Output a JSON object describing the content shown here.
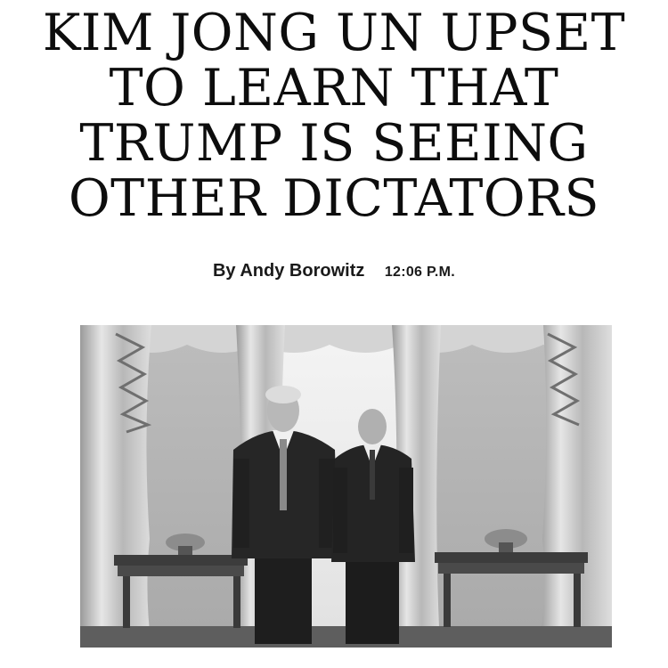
{
  "article": {
    "headline_lines": [
      "KIM JONG UN UPSET",
      "TO LEARN THAT",
      "TRUMP IS SEEING",
      "OTHER DICTATORS"
    ],
    "byline": "By Andy Borowitz",
    "timestamp": "12:06 P.M."
  },
  "photo": {
    "color_mode": "grayscale"
  }
}
